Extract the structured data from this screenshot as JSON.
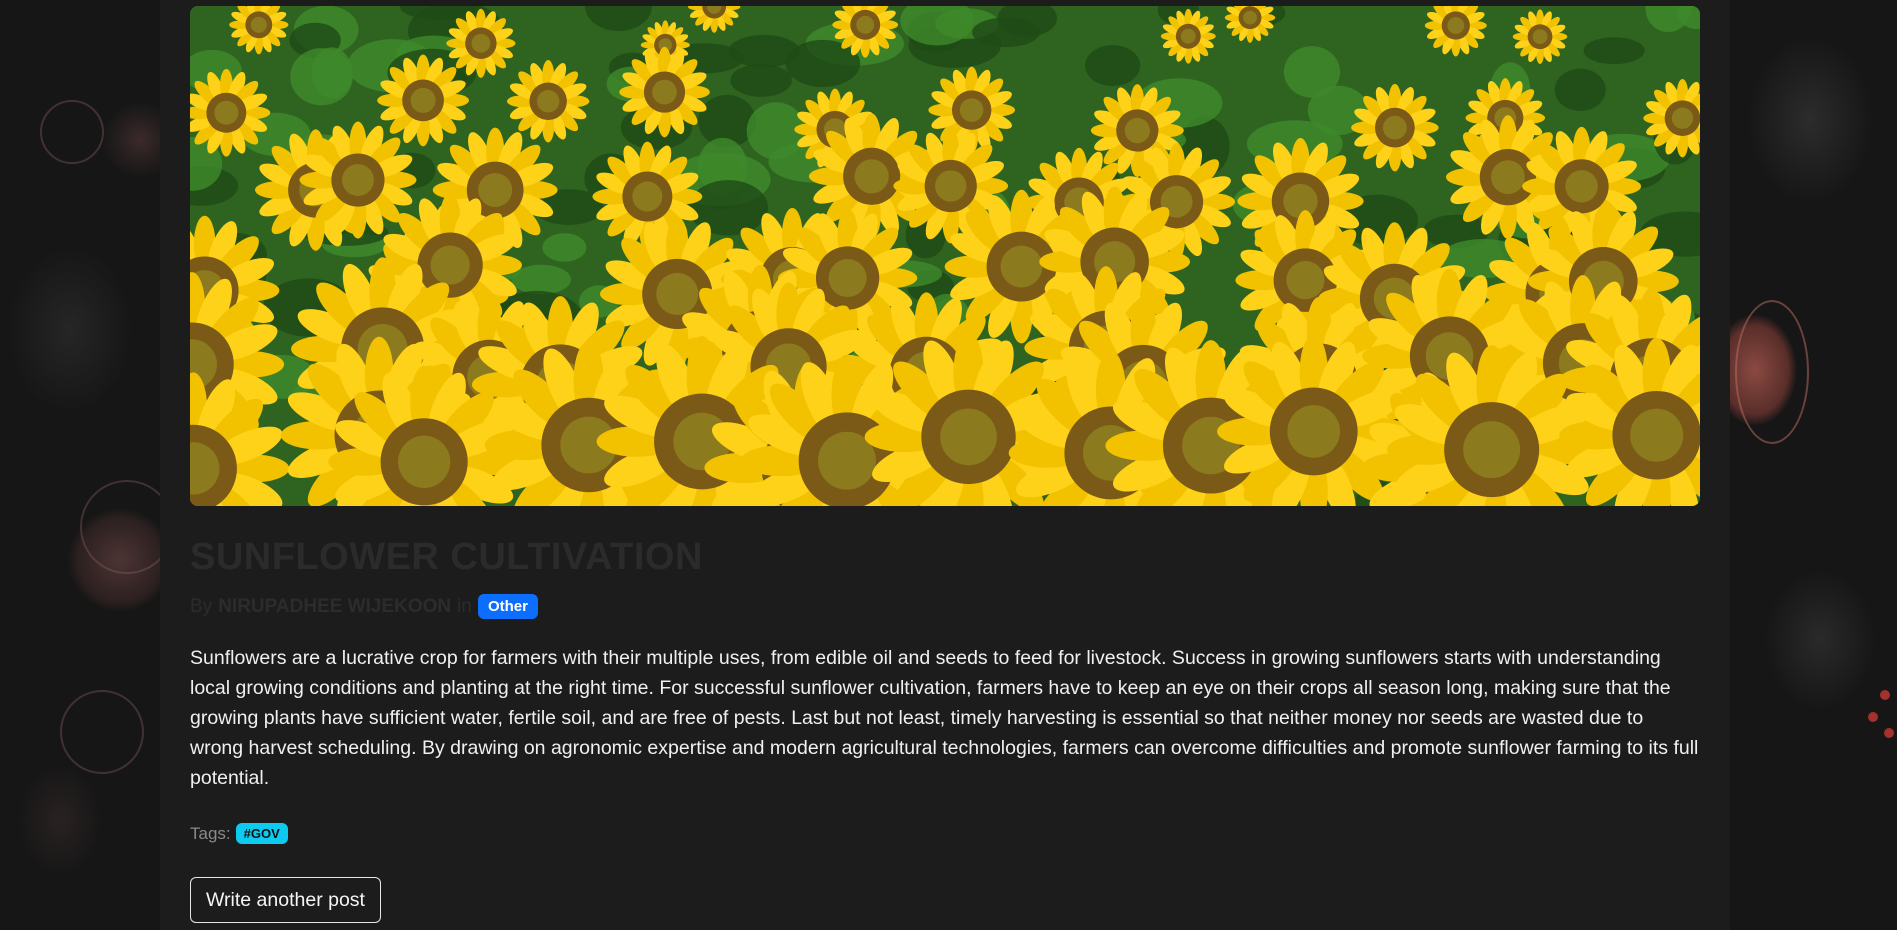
{
  "post": {
    "title": "SUNFLOWER CULTIVATION",
    "by_prefix": "By",
    "author": "NIRUPADHEE WIJEKOON",
    "in_word": "in",
    "category": "Other",
    "body": "Sunflowers are a lucrative crop for farmers with their multiple uses, from edible oil and seeds to feed for livestock. Success in growing sunflowers starts with understanding local growing conditions and planting at the right time. For successful sunflower cultivation, farmers have to keep an eye on their crops all season long, making sure that the growing plants have sufficient water, fertile soil, and are free of pests. Last but not least, timely harvesting is essential so that neither money nor seeds are wasted due to wrong harvest scheduling. By drawing on agronomic expertise and modern agricultural technologies, farmers can overcome difficulties and promote sunflower farming to its full potential.",
    "tags_label": "Tags:",
    "tags": [
      "#GOV"
    ],
    "write_button": "Write another post",
    "hero_image": "sunflower-field-photo"
  },
  "colors": {
    "panel": "#1c1c1d",
    "category_badge": "#0d6efd",
    "tag_badge": "#0dcaf0",
    "title_text": "#2b2b2c",
    "body_text": "#f0f0f0"
  }
}
